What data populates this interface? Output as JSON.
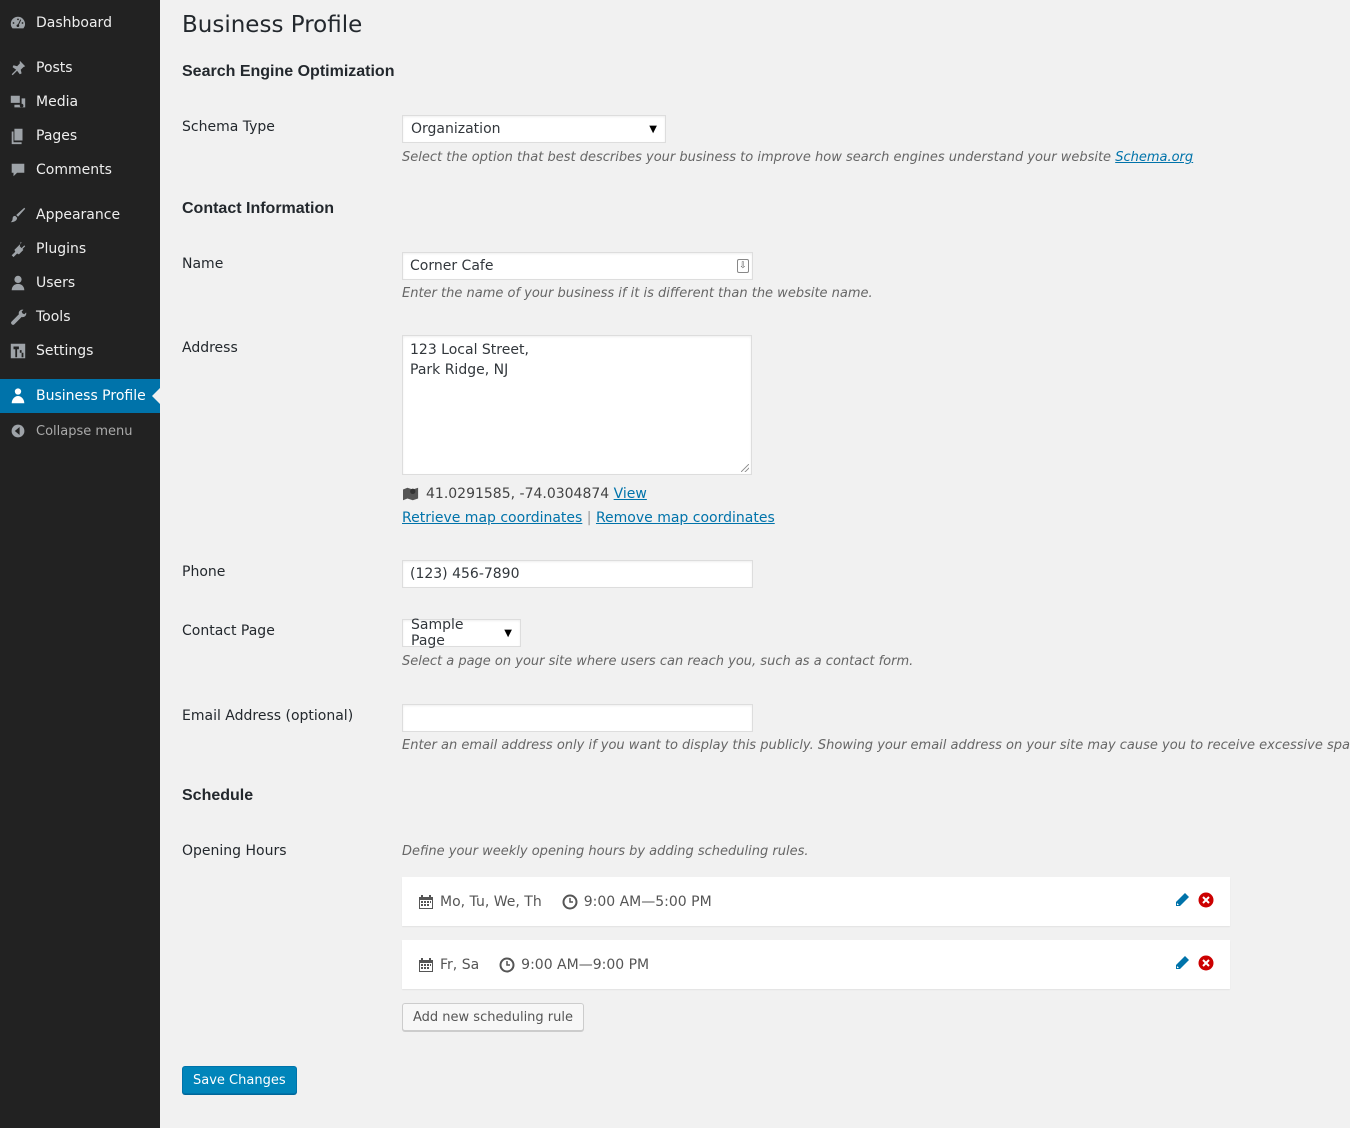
{
  "sidebar": {
    "items": [
      {
        "label": "Dashboard",
        "icon": "dashboard-icon"
      },
      {
        "label": "Posts",
        "icon": "pin-icon"
      },
      {
        "label": "Media",
        "icon": "media-icon"
      },
      {
        "label": "Pages",
        "icon": "pages-icon"
      },
      {
        "label": "Comments",
        "icon": "comment-icon"
      },
      {
        "label": "Appearance",
        "icon": "brush-icon"
      },
      {
        "label": "Plugins",
        "icon": "plug-icon"
      },
      {
        "label": "Users",
        "icon": "user-icon"
      },
      {
        "label": "Tools",
        "icon": "wrench-icon"
      },
      {
        "label": "Settings",
        "icon": "settings-icon"
      },
      {
        "label": "Business Profile",
        "icon": "business-profile-icon",
        "active": true
      },
      {
        "label": "Collapse menu",
        "icon": "collapse-icon"
      }
    ]
  },
  "page": {
    "title": "Business Profile"
  },
  "seo": {
    "section_title": "Search Engine Optimization",
    "schema_type_label": "Schema Type",
    "schema_type_value": "Organization",
    "schema_type_desc": "Select the option that best describes your business to improve how search engines understand your website",
    "schema_link": "Schema.org"
  },
  "contact": {
    "section_title": "Contact Information",
    "name_label": "Name",
    "name_value": "Corner Cafe",
    "name_desc": "Enter the name of your business if it is different than the website name.",
    "address_label": "Address",
    "address_line1": "123 Local Street,",
    "address_line2": "Park Ridge, NJ",
    "coordinates": "41.0291585, -74.0304874",
    "view_link": "View",
    "retrieve_link": "Retrieve map coordinates",
    "separator": "|",
    "remove_link": "Remove map coordinates",
    "phone_label": "Phone",
    "phone_value": "(123) 456-7890",
    "contact_page_label": "Contact Page",
    "contact_page_value": "Sample Page",
    "contact_page_desc": "Select a page on your site where users can reach you, such as a contact form.",
    "email_label": "Email Address (optional)",
    "email_value": "",
    "email_desc": "Enter an email address only if you want to display this publicly. Showing your email address on your site may cause you to receive excessive spam."
  },
  "schedule": {
    "section_title": "Schedule",
    "opening_hours_label": "Opening Hours",
    "opening_hours_desc": "Define your weekly opening hours by adding scheduling rules.",
    "rules": [
      {
        "days": "Mo, Tu, We, Th",
        "hours": "9:00 AM—5:00 PM"
      },
      {
        "days": "Fr, Sa",
        "hours": "9:00 AM—9:00 PM"
      }
    ],
    "add_rule_label": "Add new scheduling rule"
  },
  "save_label": "Save Changes",
  "colors": {
    "sidebar_bg": "#222222",
    "active_bg": "#0073aa",
    "primary_button": "#0085ba",
    "link": "#0073aa",
    "delete": "#cc0000"
  }
}
